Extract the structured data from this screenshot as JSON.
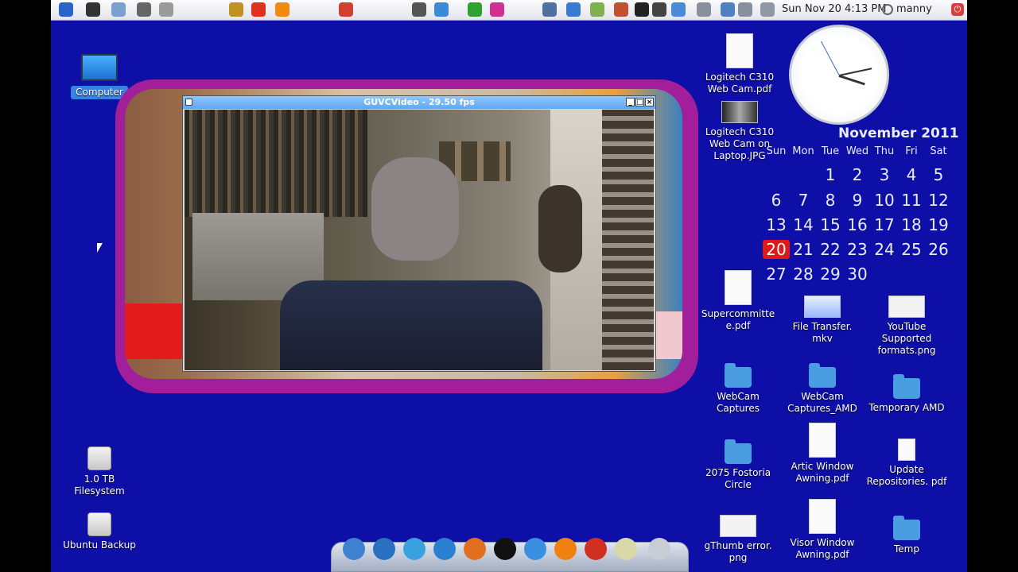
{
  "panel": {
    "clock": "Sun Nov 20  4:13 PM",
    "user": "manny",
    "launchers": [
      {
        "icon": "ubuntu-logo-icon",
        "color": "#2a64c8"
      },
      {
        "icon": "binoculars-icon",
        "color": "#333333"
      },
      {
        "icon": "file-manager-icon",
        "color": "#7aa0d0"
      },
      {
        "icon": "printer-icon",
        "color": "#666666"
      },
      {
        "icon": "text-editor-icon",
        "color": "#9a9a9a"
      },
      {
        "icon": "settings-app-icon",
        "color": "#c09020"
      },
      {
        "icon": "flame-app-icon",
        "color": "#e03020"
      },
      {
        "icon": "firefox-icon",
        "color": "#f08a10"
      },
      {
        "icon": "gmail-icon",
        "color": "#d04030"
      },
      {
        "icon": "scanner-icon",
        "color": "#555555"
      },
      {
        "icon": "network-app-icon",
        "color": "#3a8ad8"
      },
      {
        "icon": "download-icon",
        "color": "#30a030"
      },
      {
        "icon": "diamond-app-icon",
        "color": "#d03090"
      },
      {
        "icon": "screenshot-icon",
        "color": "#5070a0"
      },
      {
        "icon": "globe-icon",
        "color": "#3a7ad0"
      },
      {
        "icon": "disk-icon",
        "color": "#80b050"
      },
      {
        "icon": "people-icon",
        "color": "#c05030"
      },
      {
        "icon": "terminal-icon",
        "color": "#222222"
      },
      {
        "icon": "monitor-icon",
        "color": "#444444"
      },
      {
        "icon": "display-icon",
        "color": "#4a8ad8"
      },
      {
        "icon": "network-indicator-icon",
        "color": "#8890a0"
      },
      {
        "icon": "mail-indicator-icon",
        "color": "#5080c0"
      },
      {
        "icon": "volume-icon",
        "color": "#8890a0"
      },
      {
        "icon": "battery-icon",
        "color": "#9098a8"
      }
    ]
  },
  "desktop": {
    "computer_label": "Computer",
    "filesystem_label": "1.0 TB Filesystem",
    "backup_label": "Ubuntu Backup",
    "files": [
      "Logitech C310 Web Cam.pdf",
      "Logitech C310 Web Cam on Laptop.JPG",
      "Supercommitte e.pdf",
      "File Transfer. mkv",
      "YouTube Supported formats.png",
      "WebCam Captures",
      "WebCam Captures_AMD",
      "Temporary AMD",
      "2075 Fostoria Circle",
      "Artic Window Awning.pdf",
      "Update Repositories. pdf",
      "gThumb error. png",
      "Visor Window Awning.pdf",
      "Temp"
    ]
  },
  "window": {
    "title": "GUVCVideo - 29.50 fps",
    "minimize": "_",
    "maximize": "□",
    "close": "×"
  },
  "calendar": {
    "month": "November 2011",
    "weekdays": [
      "Sun",
      "Mon",
      "Tue",
      "Wed",
      "Thu",
      "Fri",
      "Sat"
    ],
    "weeks": [
      [
        "",
        "",
        "1",
        "2",
        "3",
        "4",
        "5"
      ],
      [
        "6",
        "7",
        "8",
        "9",
        "10",
        "11",
        "12"
      ],
      [
        "13",
        "14",
        "15",
        "16",
        "17",
        "18",
        "19"
      ],
      [
        "20",
        "21",
        "22",
        "23",
        "24",
        "25",
        "26"
      ],
      [
        "27",
        "28",
        "29",
        "30",
        "",
        "",
        ""
      ]
    ],
    "today": "20",
    "today_color": "#e01818"
  },
  "dock": {
    "items": [
      {
        "icon": "screen-dock-icon",
        "color": "#4080d0"
      },
      {
        "icon": "earth-dock-icon",
        "color": "#2a70c0"
      },
      {
        "icon": "network-dock-icon",
        "color": "#3aa0e0"
      },
      {
        "icon": "thunderbird-dock-icon",
        "color": "#2a80d0"
      },
      {
        "icon": "firefox-dock-icon",
        "color": "#e07020"
      },
      {
        "icon": "amarok-dock-icon",
        "color": "#111111"
      },
      {
        "icon": "bluetooth-dock-icon",
        "color": "#3a90e0"
      },
      {
        "icon": "vlc-dock-icon",
        "color": "#f08010"
      },
      {
        "icon": "alarm-dock-icon",
        "color": "#d03020"
      },
      {
        "icon": "notes-dock-icon",
        "color": "#d8d8a8"
      },
      {
        "icon": "trash-dock-icon",
        "color": "#c8ccd4"
      }
    ]
  },
  "colors": {
    "desktop_bg": "#0d0fa6",
    "frame": "#a31e9a",
    "titlebar": "#5fa8f2"
  }
}
